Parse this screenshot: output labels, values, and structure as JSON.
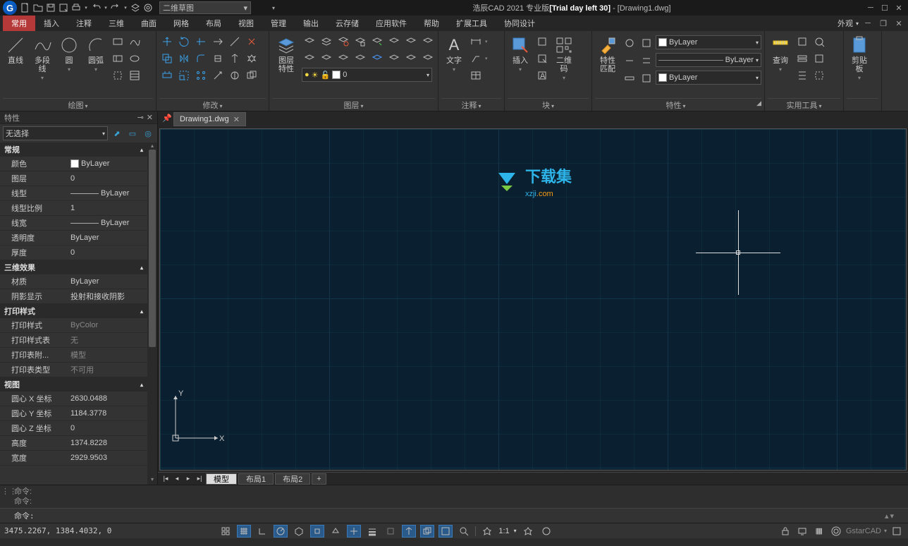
{
  "app": {
    "title_prefix": "浩辰CAD 2021 专业版",
    "title_trial": "[Trial day left 30]",
    "title_doc": "- [Drawing1.dwg]",
    "logo_letter": "G",
    "workspace": "二维草图"
  },
  "menu": {
    "tabs": [
      "常用",
      "插入",
      "注释",
      "三维",
      "曲面",
      "网格",
      "布局",
      "视图",
      "管理",
      "输出",
      "云存储",
      "应用软件",
      "帮助",
      "扩展工具",
      "协同设计"
    ],
    "active": 0,
    "appearance": "外观"
  },
  "ribbon": {
    "draw": {
      "title": "绘图",
      "line": "直线",
      "polyline": "多段线",
      "circle": "圆",
      "arc": "圆弧"
    },
    "modify": {
      "title": "修改"
    },
    "layer": {
      "title": "图层",
      "props": "图层\n特性",
      "current": "0"
    },
    "annotate": {
      "title": "注释",
      "text": "文字"
    },
    "block": {
      "title": "块",
      "insert": "插入",
      "qr": "二维码"
    },
    "props": {
      "title": "特性",
      "match": "特性\n匹配",
      "layer1": "ByLayer",
      "layer2": "ByLayer",
      "layer3": "ByLayer"
    },
    "util": {
      "title": "实用工具",
      "query": "查询"
    },
    "clip": {
      "title": "",
      "clipboard": "剪贴板"
    }
  },
  "properties": {
    "title": "特性",
    "selection": "无选择",
    "cats": {
      "general": "常规",
      "effect": "三维效果",
      "print": "打印样式",
      "view": "视图"
    },
    "rows": {
      "color": {
        "k": "颜色",
        "v": "ByLayer"
      },
      "layer": {
        "k": "图层",
        "v": "0"
      },
      "ltype": {
        "k": "线型",
        "v": "ByLayer"
      },
      "ltscale": {
        "k": "线型比例",
        "v": "1"
      },
      "lweight": {
        "k": "线宽",
        "v": "ByLayer"
      },
      "transp": {
        "k": "透明度",
        "v": "ByLayer"
      },
      "thick": {
        "k": "厚度",
        "v": "0"
      },
      "material": {
        "k": "材质",
        "v": "ByLayer"
      },
      "shadow": {
        "k": "阴影显示",
        "v": "投射和接收阴影"
      },
      "pstyle": {
        "k": "打印样式",
        "v": "ByColor"
      },
      "ptable": {
        "k": "打印样式表",
        "v": "无"
      },
      "pattach": {
        "k": "打印表附...",
        "v": "模型"
      },
      "ptype": {
        "k": "打印表类型",
        "v": "不可用"
      },
      "cx": {
        "k": "圆心 X 坐标",
        "v": "2630.0488"
      },
      "cy": {
        "k": "圆心 Y 坐标",
        "v": "1184.3778"
      },
      "cz": {
        "k": "圆心 Z 坐标",
        "v": "0"
      },
      "height": {
        "k": "高度",
        "v": "1374.8228"
      },
      "width": {
        "k": "宽度",
        "v": "2929.9503"
      }
    }
  },
  "doc": {
    "tab": "Drawing1.dwg"
  },
  "watermark": {
    "text1": "下载集",
    "text2a": "xzji",
    "text2b": ".com"
  },
  "layouts": {
    "model": "模型",
    "l1": "布局1",
    "l2": "布局2",
    "plus": "+"
  },
  "cmd": {
    "hist1": "命令:",
    "hist2": "命令:",
    "prompt": "命令:"
  },
  "status": {
    "coords": "3475.2267, 1384.4032, 0",
    "scale": "1:1",
    "brand": "GstarCAD"
  },
  "ucs": {
    "x": "X",
    "y": "Y"
  }
}
